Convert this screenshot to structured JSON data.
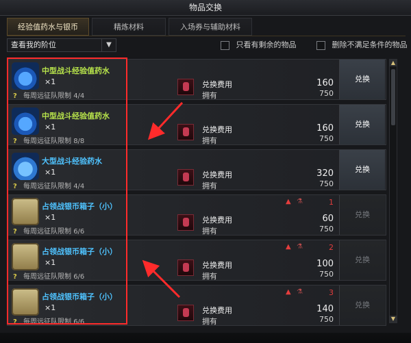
{
  "window": {
    "title": "物品交换"
  },
  "tabs": [
    {
      "label": "经验值药水与银币"
    },
    {
      "label": "精炼材料"
    },
    {
      "label": "入场券与辅助材料"
    }
  ],
  "filters": {
    "dropdown_value": "查看我的阶位",
    "checkbox_remaining": "只看有剩余的物品",
    "checkbox_remove_unmet": "删除不满足条件的物品"
  },
  "labels": {
    "cost": "兑换费用",
    "own": "拥有",
    "weekly_limit_prefix": "每周远征队限制"
  },
  "items": [
    {
      "name": "中型战斗经验值药水",
      "qty": "×1",
      "limit": "4/4",
      "cost": "160",
      "own": "750",
      "button": "兑换",
      "button_enabled": true,
      "tier": ""
    },
    {
      "name": "中型战斗经验值药水",
      "qty": "×1",
      "limit": "8/8",
      "cost": "160",
      "own": "750",
      "button": "兑换",
      "button_enabled": true,
      "tier": ""
    },
    {
      "name": "大型战斗经验药水",
      "qty": "×1",
      "limit": "4/4",
      "cost": "320",
      "own": "750",
      "button": "兑换",
      "button_enabled": true,
      "tier": ""
    },
    {
      "name": "占领战银币箱子（小）",
      "qty": "×1",
      "limit": "6/6",
      "cost": "60",
      "own": "750",
      "button": "兑换",
      "button_enabled": false,
      "tier": "1"
    },
    {
      "name": "占领战银币箱子（小）",
      "qty": "×1",
      "limit": "6/6",
      "cost": "100",
      "own": "750",
      "button": "兑换",
      "button_enabled": false,
      "tier": "2"
    },
    {
      "name": "占领战银币箱子（小）",
      "qty": "×1",
      "limit": "6/6",
      "cost": "140",
      "own": "750",
      "button": "兑换",
      "button_enabled": false,
      "tier": "3"
    }
  ],
  "icons": {
    "dropdown": "chevron-down-icon",
    "warning": "warning-triangle-icon",
    "flask": "flask-icon",
    "scroll_up": "scroll-up-icon",
    "scroll_down": "scroll-down-icon"
  },
  "colors": {
    "tab_active": "#3a3224",
    "item_name_green": "#b7e34b",
    "item_name_blue": "#4fc3ff",
    "button_enabled": "#343a42",
    "button_disabled": "#222427",
    "annotation_red": "#ff2b2b"
  }
}
